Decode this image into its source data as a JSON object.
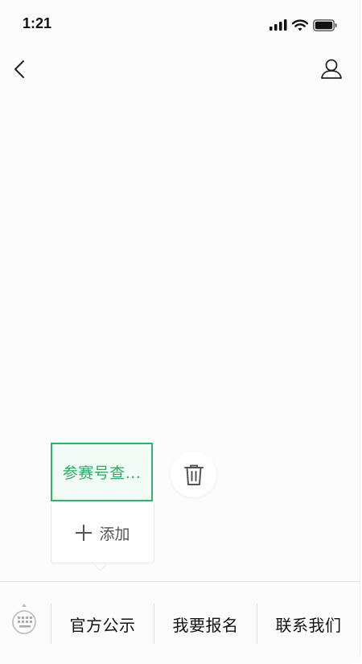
{
  "status_bar": {
    "time": "1:21",
    "icons": [
      "cellular-signal-icon",
      "wifi-icon",
      "battery-icon"
    ]
  },
  "nav_bar": {
    "back_icon": "chevron-left-icon",
    "profile_icon": "user-icon"
  },
  "menu_editor": {
    "selected_item_label": "参赛号查...",
    "add_label": "添加",
    "add_icon": "plus-icon",
    "delete_icon": "trash-icon"
  },
  "bottom_menu": {
    "keyboard_icon": "keyboard-icon",
    "tabs": [
      {
        "label": "官方公示"
      },
      {
        "label": "我要报名"
      },
      {
        "label": "联系我们"
      }
    ]
  },
  "colors": {
    "accent_green": "#29ac61",
    "selected_bg": "#f3fbf6",
    "page_bg": "#fcfcfc"
  }
}
